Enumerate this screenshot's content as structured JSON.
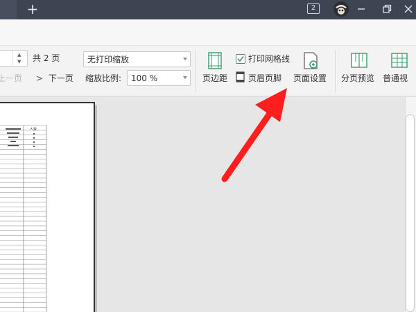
{
  "titlebar": {
    "add_tab": "+",
    "window_count": "2"
  },
  "page_nav": {
    "total_label": "共 2 页",
    "prev_label": "上一页",
    "next_label": "下一页"
  },
  "scaling": {
    "mode_value": "无打印缩放",
    "ratio_label": "缩放比例:",
    "ratio_value": "100 %"
  },
  "ribbon": {
    "margins_label": "页边距",
    "print_gridlines_label": "打印网格线",
    "print_gridlines_checked": true,
    "header_footer_label": "页眉页脚",
    "page_setup_label": "页面设置",
    "page_break_preview_label": "分页预览",
    "normal_view_label": "普通视"
  },
  "sheet": {
    "header_cell": "人数"
  },
  "colors": {
    "titlebar": "#3d4452",
    "ribbon": "#f3f3f3",
    "workspace": "#e6e6e6",
    "accent_green": "#3a9a6b",
    "annotation_arrow": "#ff1e1e"
  },
  "annotation": {
    "type": "arrow",
    "points_to": "页面设置"
  }
}
